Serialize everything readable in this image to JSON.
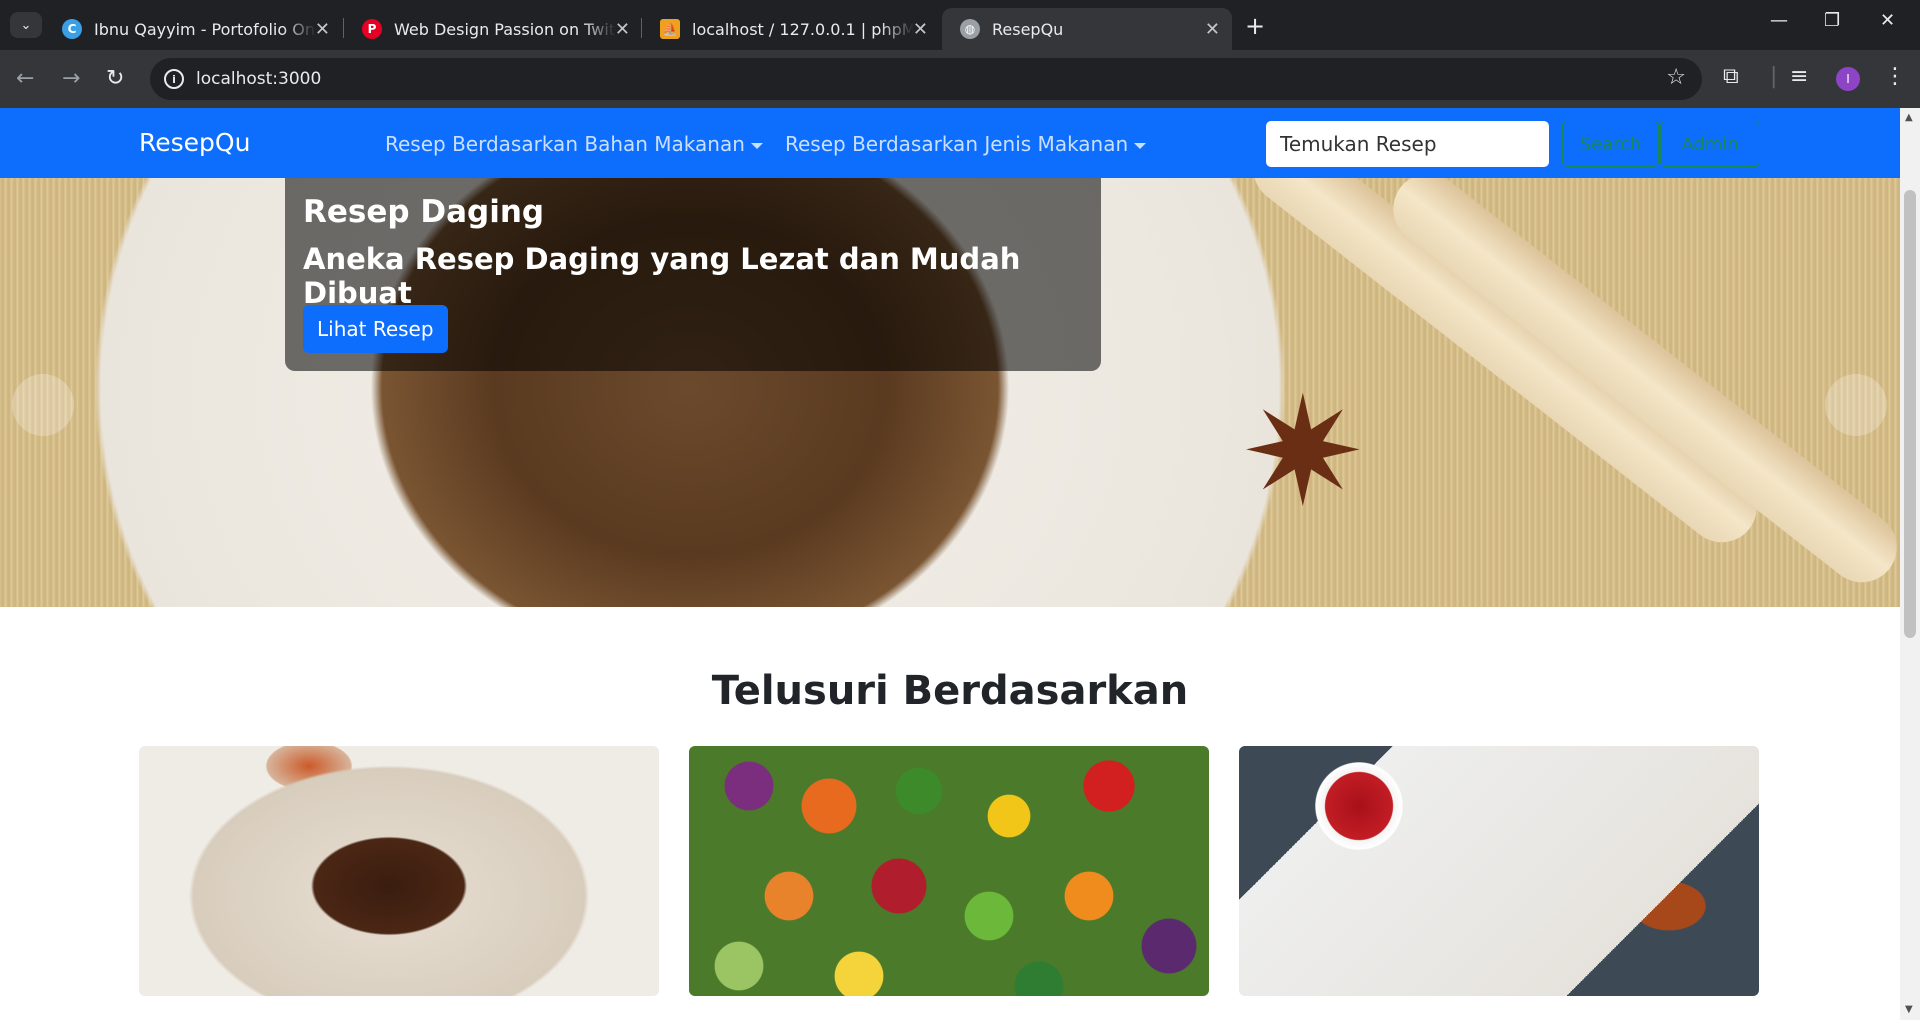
{
  "browser": {
    "tabs": [
      {
        "title": "Ibnu Qayyim - Portofolio Online",
        "favicon": "canva-icon",
        "active": false
      },
      {
        "title": "Web Design Passion on Twitter",
        "favicon": "pinterest-icon",
        "active": false
      },
      {
        "title": "localhost / 127.0.0.1 | phpMyAdmin",
        "favicon": "phpmyadmin-icon",
        "active": false
      },
      {
        "title": "ResepQu",
        "favicon": "globe-icon",
        "active": true
      }
    ],
    "url": "localhost:3000",
    "profile_initial": "I"
  },
  "navbar": {
    "brand": "ResepQu",
    "menu": [
      {
        "label": "Resep Berdasarkan Bahan Makanan"
      },
      {
        "label": "Resep Berdasarkan Jenis Makanan"
      }
    ],
    "search_placeholder": "Temukan Resep",
    "search_button": "Search",
    "admin_button": "Admin",
    "colors": {
      "primary": "#0d6efd",
      "success": "#198754"
    }
  },
  "hero": {
    "title": "Resep Daging",
    "subtitle": "Aneka Resep Daging yang Lezat dan Mudah Dibuat",
    "button": "Lihat Resep"
  },
  "browse": {
    "title": "Telusuri Berdasarkan"
  }
}
